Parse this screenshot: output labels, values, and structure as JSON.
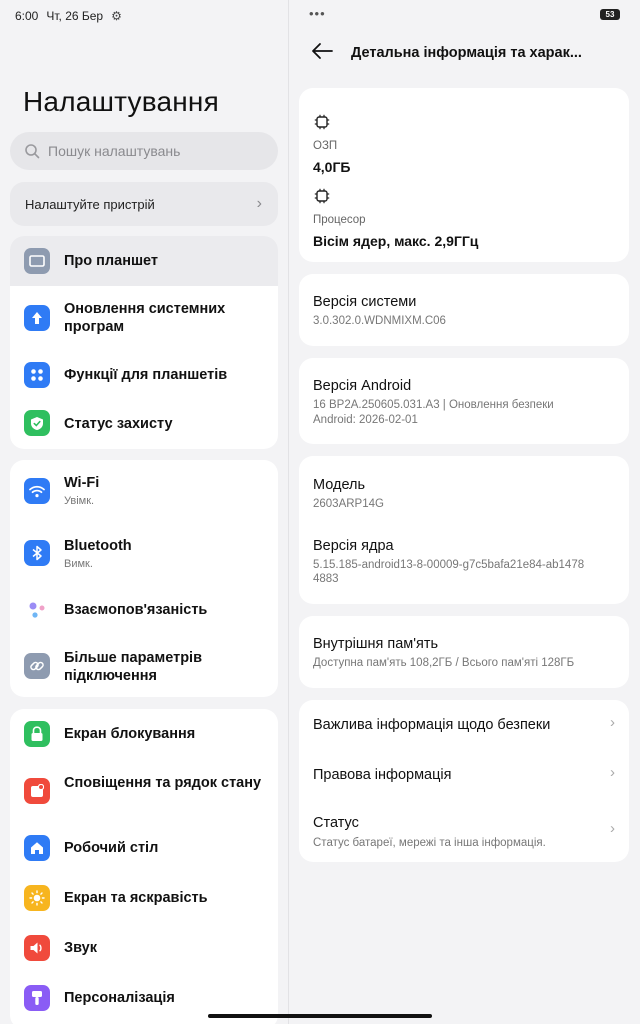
{
  "status": {
    "time": "6:00",
    "date": "Чт, 26 Бер",
    "battery": "53"
  },
  "left": {
    "title": "Налаштування",
    "search_placeholder": "Пошук налаштувань",
    "setup_label": "Налаштуйте пристрій",
    "group1": [
      {
        "label": "Про планшет",
        "icon": "tablet-icon",
        "color": "#8e9bb0"
      },
      {
        "label": "Оновлення системних програм",
        "icon": "arrow-up-icon",
        "color": "#2f7bf5"
      },
      {
        "label": "Функції для планшетів",
        "icon": "grid-icon",
        "color": "#2f7bf5"
      },
      {
        "label": "Статус захисту",
        "icon": "shield-check-icon",
        "color": "#2fbf5f"
      }
    ],
    "group2": [
      {
        "label": "Wi-Fi",
        "sub": "Увімк.",
        "icon": "wifi-icon",
        "color": "#2f7bf5"
      },
      {
        "label": "Bluetooth",
        "sub": "Вимк.",
        "icon": "bluetooth-icon",
        "color": "#2f7bf5"
      },
      {
        "label": "Взаємопов'язаність",
        "icon": "interconnect-icon",
        "color": "#b58cf0"
      },
      {
        "label": "Більше параметрів підключення",
        "icon": "link-icon",
        "color": "#8e9bb0"
      }
    ],
    "group3": [
      {
        "label": "Екран блокування",
        "icon": "lock-icon",
        "color": "#2fbf5f"
      },
      {
        "label": "Сповіщення та рядок стану",
        "icon": "notification-icon",
        "color": "#f04a3c"
      },
      {
        "label": "Робочий стіл",
        "icon": "home-icon",
        "color": "#2f7bf5"
      },
      {
        "label": "Екран та яскравість",
        "icon": "sun-icon",
        "color": "#f7b51f"
      },
      {
        "label": "Звук",
        "icon": "speaker-icon",
        "color": "#f04a3c"
      },
      {
        "label": "Персоналізація",
        "icon": "brush-icon",
        "color": "#8a5cf5"
      }
    ]
  },
  "right": {
    "title": "Детальна інформація та харак...",
    "ram_label": "ОЗП",
    "ram_value": "4,0ГБ",
    "cpu_label": "Процесор",
    "cpu_value": "Вісім ядер, макс. 2,9ГГц",
    "system_version_title": "Версія системи",
    "system_version_value": "3.0.302.0.WDNMIXM.C06",
    "android_version_title": "Версія Android",
    "android_version_line1": "16 BP2A.250605.031.A3 | Оновлення безпеки",
    "android_version_line2": "Android: 2026-02-01",
    "model_title": "Модель",
    "model_value": "2603ARP14G",
    "kernel_title": "Версія ядра",
    "kernel_line1": "5.15.185-android13-8-00009-g7c5bafa21e84-ab1478",
    "kernel_line2": "4883",
    "storage_title": "Внутрішня пам'ять",
    "storage_value": "Доступна пам'ять  108,2ГБ / Всього пам'яті  128ГБ",
    "safety_info": "Важлива інформація щодо безпеки",
    "legal_info": "Правова інформація",
    "status_title": "Статус",
    "status_sub": "Статус батареї, мережі та інша інформація."
  }
}
